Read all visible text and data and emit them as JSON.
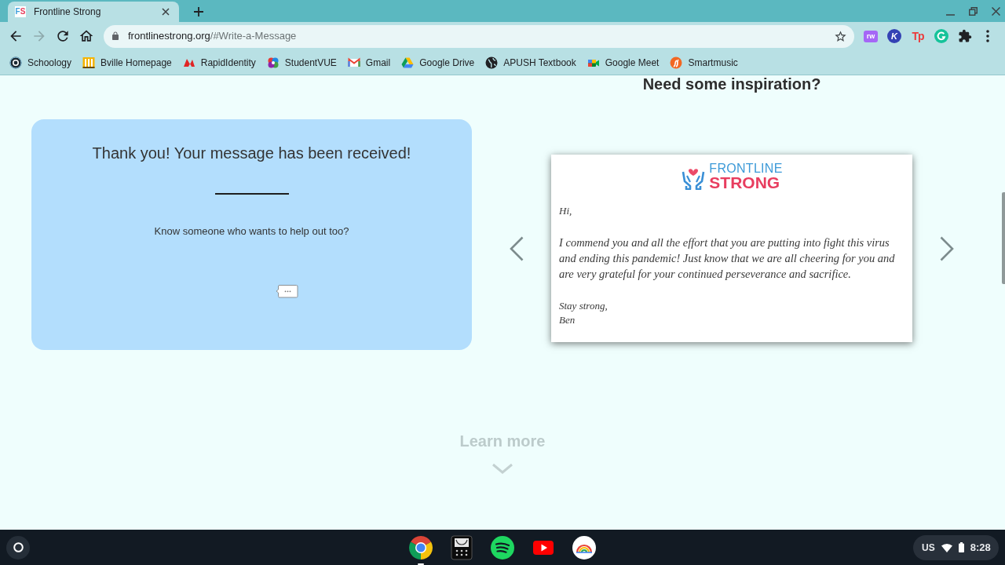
{
  "browser": {
    "tabs": [
      {
        "favicon": "FS",
        "title": "Frontline Strong",
        "selected": true
      }
    ],
    "nav_buttons": [
      {
        "kind": "back",
        "disabled": false
      },
      {
        "kind": "forward",
        "disabled": true
      },
      {
        "kind": "reload",
        "disabled": false
      },
      {
        "kind": "home",
        "disabled": false
      }
    ],
    "address_bar": {
      "domain": "frontlinestrong.org",
      "path": "/#Write-a-Message"
    },
    "extensions": [
      {
        "kind": "tile",
        "label": "rw"
      },
      {
        "kind": "disc",
        "label": "K"
      },
      {
        "kind": "plain",
        "label": "Tp"
      }
    ],
    "bookmarks": [
      {
        "label": "Schoology"
      },
      {
        "label": "Bville Homepage"
      },
      {
        "label": "RapidIdentity"
      },
      {
        "label": "StudentVUE"
      },
      {
        "label": "Gmail"
      },
      {
        "label": "Google Drive"
      },
      {
        "label": "APUSH Textbook"
      },
      {
        "label": "Google Meet"
      },
      {
        "label": "Smartmusic"
      }
    ]
  },
  "page": {
    "inspiration": {
      "heading": "Need some inspiration?",
      "letter": {
        "logo": [
          "FRONTLINE",
          "STRONG"
        ],
        "greeting": "Hi,",
        "body": "I commend you and all the effort that you are putting into fight this virus and ending this pandemic! Just know that we are all cheering for you and are very grateful for your continued perseverance and sacrifice.",
        "closing": "Stay strong,",
        "signature": "Ben"
      }
    },
    "confirmation": {
      "title": "Thank you! Your message has been received!",
      "prompt": "Know someone who wants to help out too?"
    },
    "learn_more": "Learn more"
  },
  "shelf": {
    "apps": [
      {
        "kind": "browser",
        "running": true
      },
      {
        "kind": "calculator",
        "running": false
      },
      {
        "kind": "music",
        "running": false
      },
      {
        "kind": "video",
        "running": false
      },
      {
        "kind": "canvas",
        "running": false
      }
    ],
    "status": {
      "keyboard": "US",
      "time": "8:28"
    }
  }
}
